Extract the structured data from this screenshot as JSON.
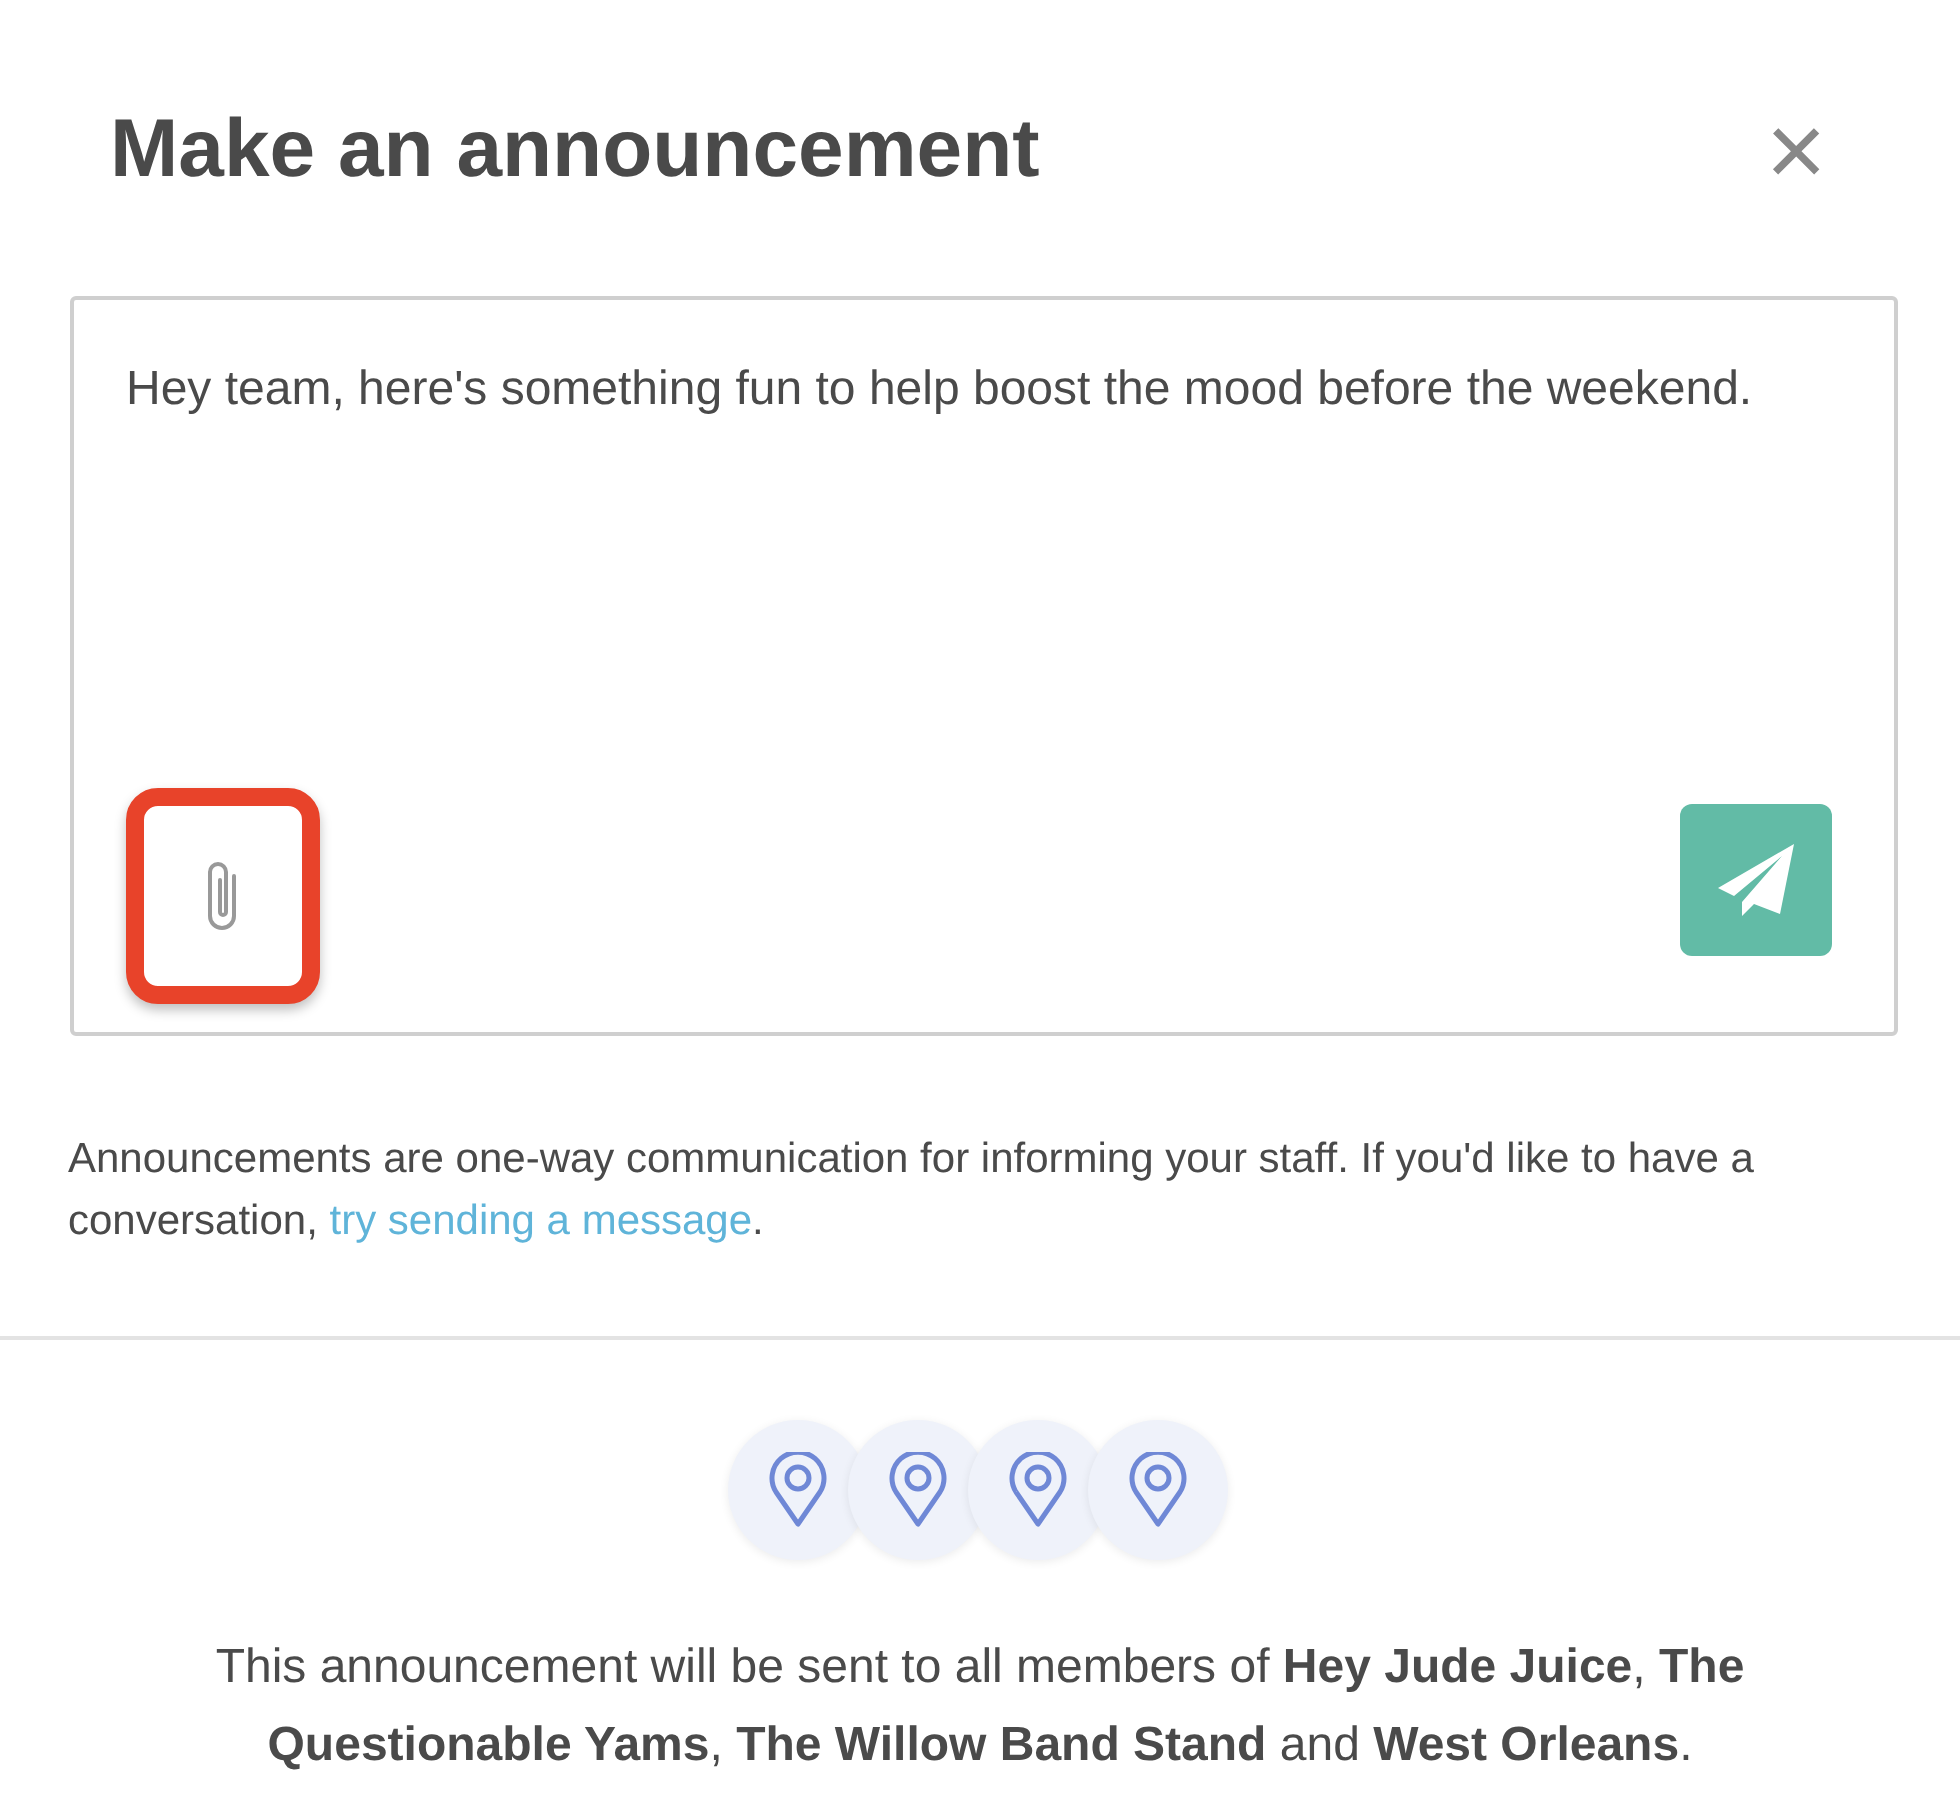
{
  "dialog": {
    "title": "Make an announcement",
    "close_label": "×"
  },
  "message": {
    "value": "Hey team, here's something fun to help boost the mood before the weekend.",
    "attach": {
      "highlighted": true
    }
  },
  "info": {
    "text": "Announcements are one-way communication for informing your staff. If you'd like to have a conversation, ",
    "link": "try sending a message",
    "after": "."
  },
  "audience_icons": [
    {
      "kind": "location"
    },
    {
      "kind": "location"
    },
    {
      "kind": "location"
    },
    {
      "kind": "location"
    }
  ],
  "recipients_text": "This announcement will be sent to all members of **Hey Jude Juice**, **The Questionable Yams**, **The Willow Band Stand** and **West Orleans**."
}
